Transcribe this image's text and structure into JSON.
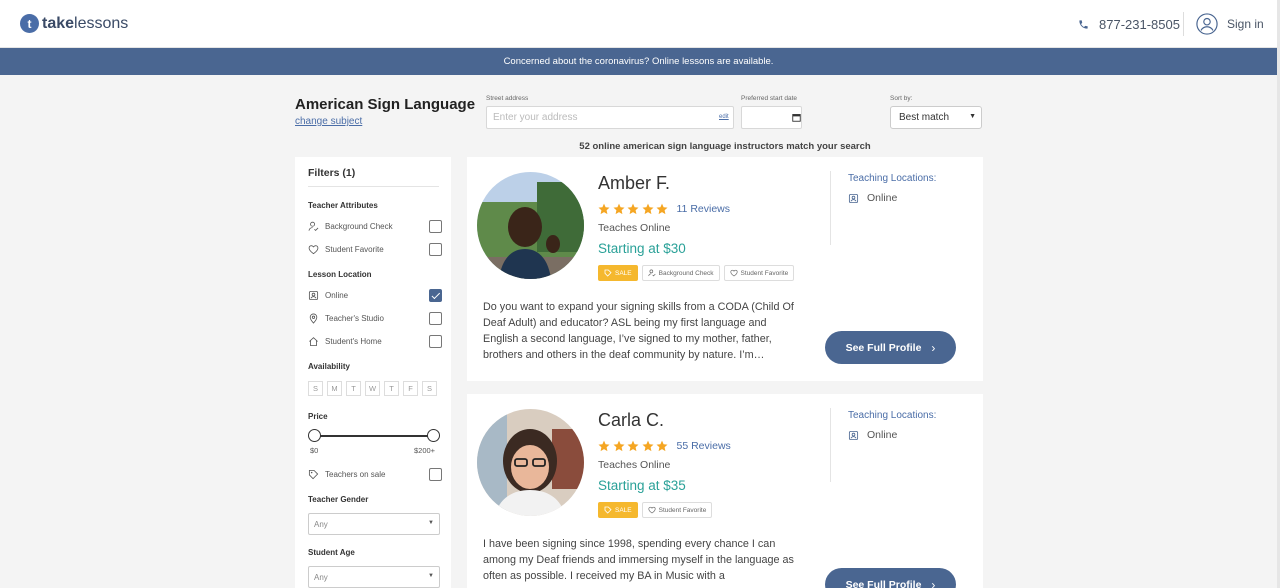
{
  "header": {
    "logo_take": "take",
    "logo_lessons": "lessons",
    "phone": "877-231-8505",
    "signin_label": "Sign in"
  },
  "banner": {
    "text": "Concerned about the coronavirus? Online lessons are available."
  },
  "search": {
    "subject_title": "American Sign Language",
    "change_subject": "change subject",
    "address_label": "Street address",
    "address_placeholder": "Enter your address",
    "address_edit": "edit",
    "date_label": "Preferred start date",
    "sort_label": "Sort by:",
    "sort_value": "Best match",
    "match_count": "52 online american sign language instructors match your search"
  },
  "filters": {
    "title": "Filters (1)",
    "attributes_label": "Teacher Attributes",
    "background_check": "Background Check",
    "student_favorite": "Student Favorite",
    "location_label": "Lesson Location",
    "online": "Online",
    "teachers_studio": "Teacher's Studio",
    "students_home": "Student's Home",
    "availability_label": "Availability",
    "days": [
      "S",
      "M",
      "T",
      "W",
      "T",
      "F",
      "S"
    ],
    "price_label": "Price",
    "price_min": "$0",
    "price_max": "$200+",
    "teachers_on_sale": "Teachers on sale",
    "gender_label": "Teacher Gender",
    "gender_value": "Any",
    "age_label": "Student Age",
    "age_value": "Any",
    "checked": {
      "online": true
    }
  },
  "teachers": [
    {
      "name": "Amber F.",
      "reviews": "11 Reviews",
      "teaches": "Teaches Online",
      "price": "Starting at $30",
      "badge_sale": "SALE",
      "badge_bg": "Background Check",
      "badge_fav": "Student Favorite",
      "locations_title": "Teaching Locations:",
      "location": "Online",
      "bio": "Do you want to expand your signing skills from a CODA (Child Of Deaf Adult) and educator? ASL being my first language and English a second language, I’ve signed to my mother, father, brothers and others in the deaf community by nature. I’m…",
      "button": "See Full Profile"
    },
    {
      "name": "Carla C.",
      "reviews": "55 Reviews",
      "teaches": "Teaches Online",
      "price": "Starting at $35",
      "badge_sale": "SALE",
      "badge_fav": "Student Favorite",
      "locations_title": "Teaching Locations:",
      "location": "Online",
      "bio": "I have been signing since 1998, spending every chance I can among my Deaf friends and immersing myself in the language as often as possible. I received my BA in Music with a",
      "button": "See Full Profile"
    }
  ],
  "colors": {
    "brand_blue": "#4a6691",
    "link_blue": "#4a6da7",
    "price_teal": "#2aa198",
    "star_orange": "#f5a623",
    "sale_yellow": "#f5b82e"
  },
  "icons": [
    "logo-icon",
    "phone-icon",
    "user-circle-icon",
    "calendar-icon",
    "person-check-icon",
    "heart-icon",
    "laptop-icon",
    "map-pin-icon",
    "home-icon",
    "tag-icon",
    "star-icon",
    "chevron-right-icon"
  ]
}
